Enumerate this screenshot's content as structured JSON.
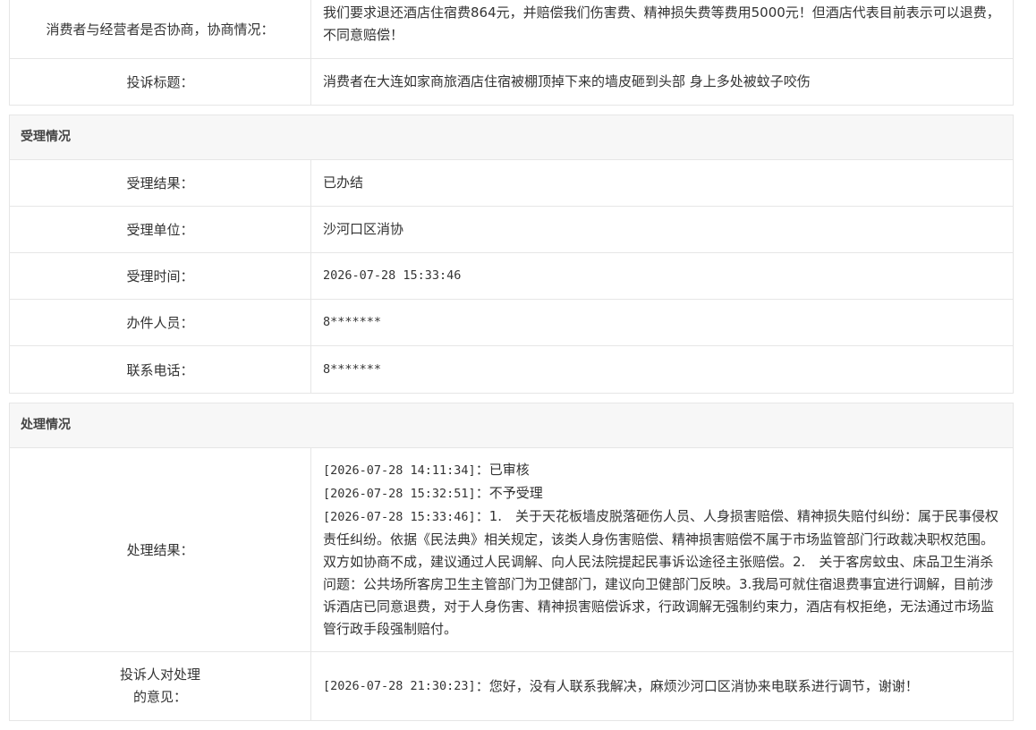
{
  "complaint": {
    "rows": [
      {
        "label": "消费者与经营者是否协商，协商情况：",
        "value": "我们要求退还酒店住宿费864元，并赔偿我们伤害费、精神损失费等费用5000元！但酒店代表目前表示可以退费，不同意赔偿！"
      },
      {
        "label": "投诉标题：",
        "value": "消费者在大连如家商旅酒店住宿被棚顶掉下来的墙皮砸到头部 身上多处被蚊子咬伤"
      }
    ]
  },
  "acceptance": {
    "title": "受理情况",
    "rows": [
      {
        "label": "受理结果：",
        "value": "已办结"
      },
      {
        "label": "受理单位：",
        "value": "沙河口区消协"
      },
      {
        "label": "受理时间：",
        "value": "2026-07-28 15:33:46"
      },
      {
        "label": "办件人员：",
        "value": "8*******"
      },
      {
        "label": "联系电话：",
        "value": "8*******"
      }
    ]
  },
  "handling": {
    "title": "处理情况",
    "result_label": "处理结果：",
    "result_lines": [
      {
        "time": "[2026-07-28 14:11:34]",
        "text": "：已审核"
      },
      {
        "time": "[2026-07-28 15:32:51]",
        "text": "：不予受理"
      },
      {
        "time": "[2026-07-28 15:33:46]",
        "text": "：1.　关于天花板墙皮脱落砸伤人员、人身损害赔偿、精神损失赔付纠纷：属于民事侵权责任纠纷。依据《民法典》相关规定，该类人身伤害赔偿、精神损害赔偿不属于市场监管部门行政裁决职权范围。双方如协商不成，建议通过人民调解、向人民法院提起民事诉讼途径主张赔偿。2.　关于客房蚊虫、床品卫生消杀问题：公共场所客房卫生主管部门为卫健部门，建议向卫健部门反映。3.我局可就住宿退费事宜进行调解，目前涉诉酒店已同意退费，对于人身伤害、精神损害赔偿诉求，行政调解无强制约束力，酒店有权拒绝，无法通过市场监管行政手段强制赔付。"
      }
    ],
    "opinion_label_line1": "投诉人对处理",
    "opinion_label_line2": "的意见：",
    "opinion": {
      "time": "[2026-07-28 21:30:23]",
      "text": "：您好，没有人联系我解决，麻烦沙河口区消协来电联系进行调节，谢谢！"
    }
  }
}
